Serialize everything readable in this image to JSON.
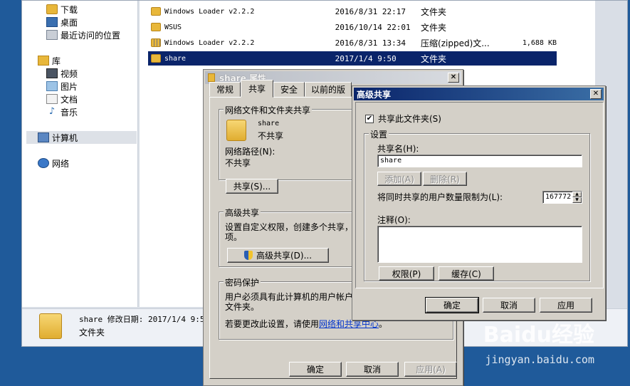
{
  "nav": {
    "items": [
      {
        "label": "下载",
        "icon": "download-folder-icon"
      },
      {
        "label": "桌面",
        "icon": "desktop-icon"
      },
      {
        "label": "最近访问的位置",
        "icon": "recent-places-icon"
      },
      {
        "label": "库",
        "icon": "library-icon"
      },
      {
        "label": "视频",
        "icon": "video-icon"
      },
      {
        "label": "图片",
        "icon": "picture-icon"
      },
      {
        "label": "文档",
        "icon": "document-icon"
      },
      {
        "label": "音乐",
        "icon": "music-icon"
      },
      {
        "label": "计算机",
        "icon": "computer-icon"
      },
      {
        "label": "网络",
        "icon": "network-icon"
      }
    ]
  },
  "files": [
    {
      "name": "Windows Loader v2.2.2",
      "date": "2016/8/31 22:17",
      "type": "文件夹",
      "size": ""
    },
    {
      "name": "WSUS",
      "date": "2016/10/14 22:01",
      "type": "文件夹",
      "size": ""
    },
    {
      "name": "Windows Loader v2.2.2",
      "date": "2016/8/31 13:34",
      "type": "压缩(zipped)文...",
      "size": "1,688 KB"
    },
    {
      "name": "share",
      "date": "2017/1/4 9:50",
      "type": "文件夹",
      "size": ""
    }
  ],
  "details": {
    "line1": "share 修改日期: 2017/1/4 9:5(",
    "line2": "文件夹"
  },
  "props": {
    "title": "share 属性",
    "tabs": [
      "常规",
      "共享",
      "安全",
      "以前的版"
    ],
    "net_group": "网络文件和文件夹共享",
    "folder_name": "share",
    "folder_status": "不共享",
    "net_path_label": "网络路径(N):",
    "net_path_value": "不共享",
    "share_button": "共享(S)...",
    "adv_group": "高级共享",
    "adv_desc_1": "设置自定义权限，创建多个共享，",
    "adv_desc_2": "项。",
    "adv_button": "高级共享(D)...",
    "pw_group": "密码保护",
    "pw_desc_1": "用户必须具有此计算机的用户帐户",
    "pw_desc_2": "文件夹。",
    "pw_change_prefix": "若要更改此设置，请使用",
    "pw_change_link": "网络和共享中心",
    "pw_change_suffix": "。",
    "ok": "确定",
    "cancel": "取消",
    "apply": "应用(A)"
  },
  "adv": {
    "title": "高级共享",
    "share_checkbox": "共享此文件夹(S)",
    "settings_group": "设置",
    "share_name_label": "共享名(H):",
    "share_name_value": "share",
    "add_button": "添加(A)",
    "remove_button": "删除(R)",
    "limit_label": "将同时共享的用户数量限制为(L):",
    "limit_value": "167772",
    "comment_label": "注释(O):",
    "permissions_button": "权限(P)",
    "cache_button": "缓存(C)",
    "ok": "确定",
    "cancel": "取消",
    "apply": "应用"
  },
  "watermark": {
    "logo": "Baidu经验",
    "url": "jingyan.baidu.com"
  }
}
